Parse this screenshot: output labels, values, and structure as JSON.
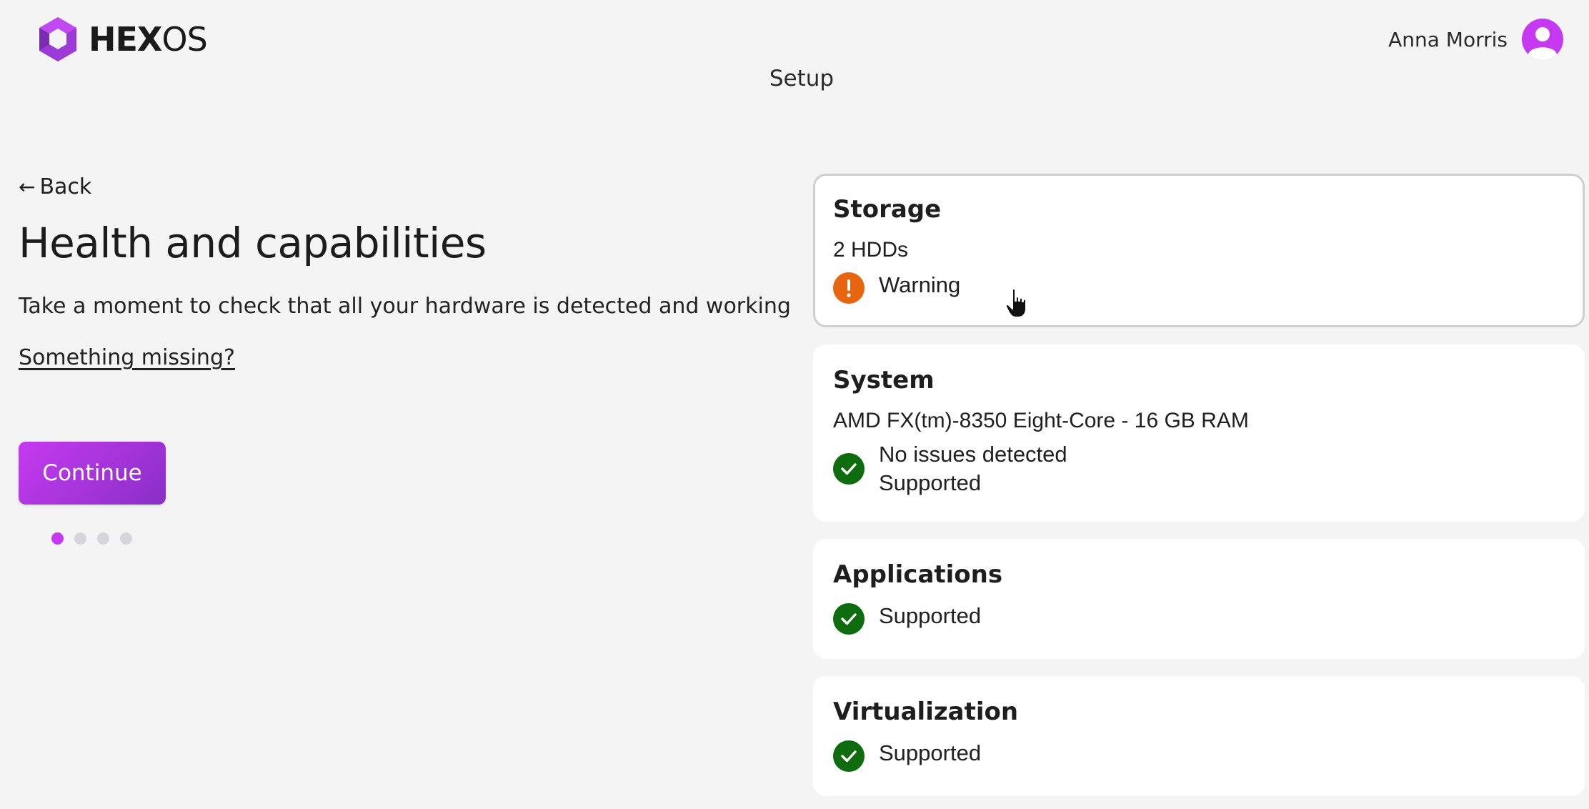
{
  "header": {
    "logo_hex": "HEX",
    "logo_os": "OS",
    "step_title": "Setup",
    "user_name": "Anna Morris"
  },
  "left": {
    "back_label": "Back",
    "heading": "Health and capabilities",
    "description": "Take a moment to check that all your hardware is detected and working",
    "missing_link": "Something missing?",
    "continue_label": "Continue",
    "progress": {
      "current_step": 1,
      "total_steps": 4
    }
  },
  "cards": [
    {
      "title": "Storage",
      "subtitle": "2 HDDs",
      "status": "warning",
      "lines": [
        "Warning"
      ]
    },
    {
      "title": "System",
      "subtitle": "AMD FX(tm)-8350 Eight-Core - 16 GB RAM",
      "status": "ok",
      "lines": [
        "No issues detected",
        "Supported"
      ]
    },
    {
      "title": "Applications",
      "status": "ok",
      "lines": [
        "Supported"
      ]
    },
    {
      "title": "Virtualization",
      "status": "ok",
      "lines": [
        "Supported"
      ]
    }
  ],
  "colors": {
    "accent": "#c53af0",
    "warning": "#e8650f",
    "success": "#0e6b0e",
    "background": "#f4f4f4"
  }
}
